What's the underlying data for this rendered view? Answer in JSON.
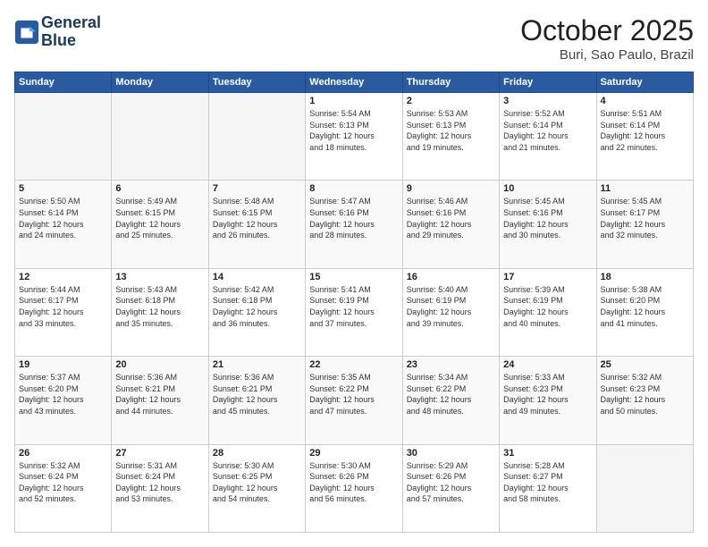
{
  "header": {
    "logo_line1": "General",
    "logo_line2": "Blue",
    "month_title": "October 2025",
    "location": "Buri, Sao Paulo, Brazil"
  },
  "weekdays": [
    "Sunday",
    "Monday",
    "Tuesday",
    "Wednesday",
    "Thursday",
    "Friday",
    "Saturday"
  ],
  "weeks": [
    [
      {
        "day": "",
        "info": ""
      },
      {
        "day": "",
        "info": ""
      },
      {
        "day": "",
        "info": ""
      },
      {
        "day": "1",
        "info": "Sunrise: 5:54 AM\nSunset: 6:13 PM\nDaylight: 12 hours\nand 18 minutes."
      },
      {
        "day": "2",
        "info": "Sunrise: 5:53 AM\nSunset: 6:13 PM\nDaylight: 12 hours\nand 19 minutes."
      },
      {
        "day": "3",
        "info": "Sunrise: 5:52 AM\nSunset: 6:14 PM\nDaylight: 12 hours\nand 21 minutes."
      },
      {
        "day": "4",
        "info": "Sunrise: 5:51 AM\nSunset: 6:14 PM\nDaylight: 12 hours\nand 22 minutes."
      }
    ],
    [
      {
        "day": "5",
        "info": "Sunrise: 5:50 AM\nSunset: 6:14 PM\nDaylight: 12 hours\nand 24 minutes."
      },
      {
        "day": "6",
        "info": "Sunrise: 5:49 AM\nSunset: 6:15 PM\nDaylight: 12 hours\nand 25 minutes."
      },
      {
        "day": "7",
        "info": "Sunrise: 5:48 AM\nSunset: 6:15 PM\nDaylight: 12 hours\nand 26 minutes."
      },
      {
        "day": "8",
        "info": "Sunrise: 5:47 AM\nSunset: 6:16 PM\nDaylight: 12 hours\nand 28 minutes."
      },
      {
        "day": "9",
        "info": "Sunrise: 5:46 AM\nSunset: 6:16 PM\nDaylight: 12 hours\nand 29 minutes."
      },
      {
        "day": "10",
        "info": "Sunrise: 5:45 AM\nSunset: 6:16 PM\nDaylight: 12 hours\nand 30 minutes."
      },
      {
        "day": "11",
        "info": "Sunrise: 5:45 AM\nSunset: 6:17 PM\nDaylight: 12 hours\nand 32 minutes."
      }
    ],
    [
      {
        "day": "12",
        "info": "Sunrise: 5:44 AM\nSunset: 6:17 PM\nDaylight: 12 hours\nand 33 minutes."
      },
      {
        "day": "13",
        "info": "Sunrise: 5:43 AM\nSunset: 6:18 PM\nDaylight: 12 hours\nand 35 minutes."
      },
      {
        "day": "14",
        "info": "Sunrise: 5:42 AM\nSunset: 6:18 PM\nDaylight: 12 hours\nand 36 minutes."
      },
      {
        "day": "15",
        "info": "Sunrise: 5:41 AM\nSunset: 6:19 PM\nDaylight: 12 hours\nand 37 minutes."
      },
      {
        "day": "16",
        "info": "Sunrise: 5:40 AM\nSunset: 6:19 PM\nDaylight: 12 hours\nand 39 minutes."
      },
      {
        "day": "17",
        "info": "Sunrise: 5:39 AM\nSunset: 6:19 PM\nDaylight: 12 hours\nand 40 minutes."
      },
      {
        "day": "18",
        "info": "Sunrise: 5:38 AM\nSunset: 6:20 PM\nDaylight: 12 hours\nand 41 minutes."
      }
    ],
    [
      {
        "day": "19",
        "info": "Sunrise: 5:37 AM\nSunset: 6:20 PM\nDaylight: 12 hours\nand 43 minutes."
      },
      {
        "day": "20",
        "info": "Sunrise: 5:36 AM\nSunset: 6:21 PM\nDaylight: 12 hours\nand 44 minutes."
      },
      {
        "day": "21",
        "info": "Sunrise: 5:36 AM\nSunset: 6:21 PM\nDaylight: 12 hours\nand 45 minutes."
      },
      {
        "day": "22",
        "info": "Sunrise: 5:35 AM\nSunset: 6:22 PM\nDaylight: 12 hours\nand 47 minutes."
      },
      {
        "day": "23",
        "info": "Sunrise: 5:34 AM\nSunset: 6:22 PM\nDaylight: 12 hours\nand 48 minutes."
      },
      {
        "day": "24",
        "info": "Sunrise: 5:33 AM\nSunset: 6:23 PM\nDaylight: 12 hours\nand 49 minutes."
      },
      {
        "day": "25",
        "info": "Sunrise: 5:32 AM\nSunset: 6:23 PM\nDaylight: 12 hours\nand 50 minutes."
      }
    ],
    [
      {
        "day": "26",
        "info": "Sunrise: 5:32 AM\nSunset: 6:24 PM\nDaylight: 12 hours\nand 52 minutes."
      },
      {
        "day": "27",
        "info": "Sunrise: 5:31 AM\nSunset: 6:24 PM\nDaylight: 12 hours\nand 53 minutes."
      },
      {
        "day": "28",
        "info": "Sunrise: 5:30 AM\nSunset: 6:25 PM\nDaylight: 12 hours\nand 54 minutes."
      },
      {
        "day": "29",
        "info": "Sunrise: 5:30 AM\nSunset: 6:26 PM\nDaylight: 12 hours\nand 56 minutes."
      },
      {
        "day": "30",
        "info": "Sunrise: 5:29 AM\nSunset: 6:26 PM\nDaylight: 12 hours\nand 57 minutes."
      },
      {
        "day": "31",
        "info": "Sunrise: 5:28 AM\nSunset: 6:27 PM\nDaylight: 12 hours\nand 58 minutes."
      },
      {
        "day": "",
        "info": ""
      }
    ]
  ]
}
